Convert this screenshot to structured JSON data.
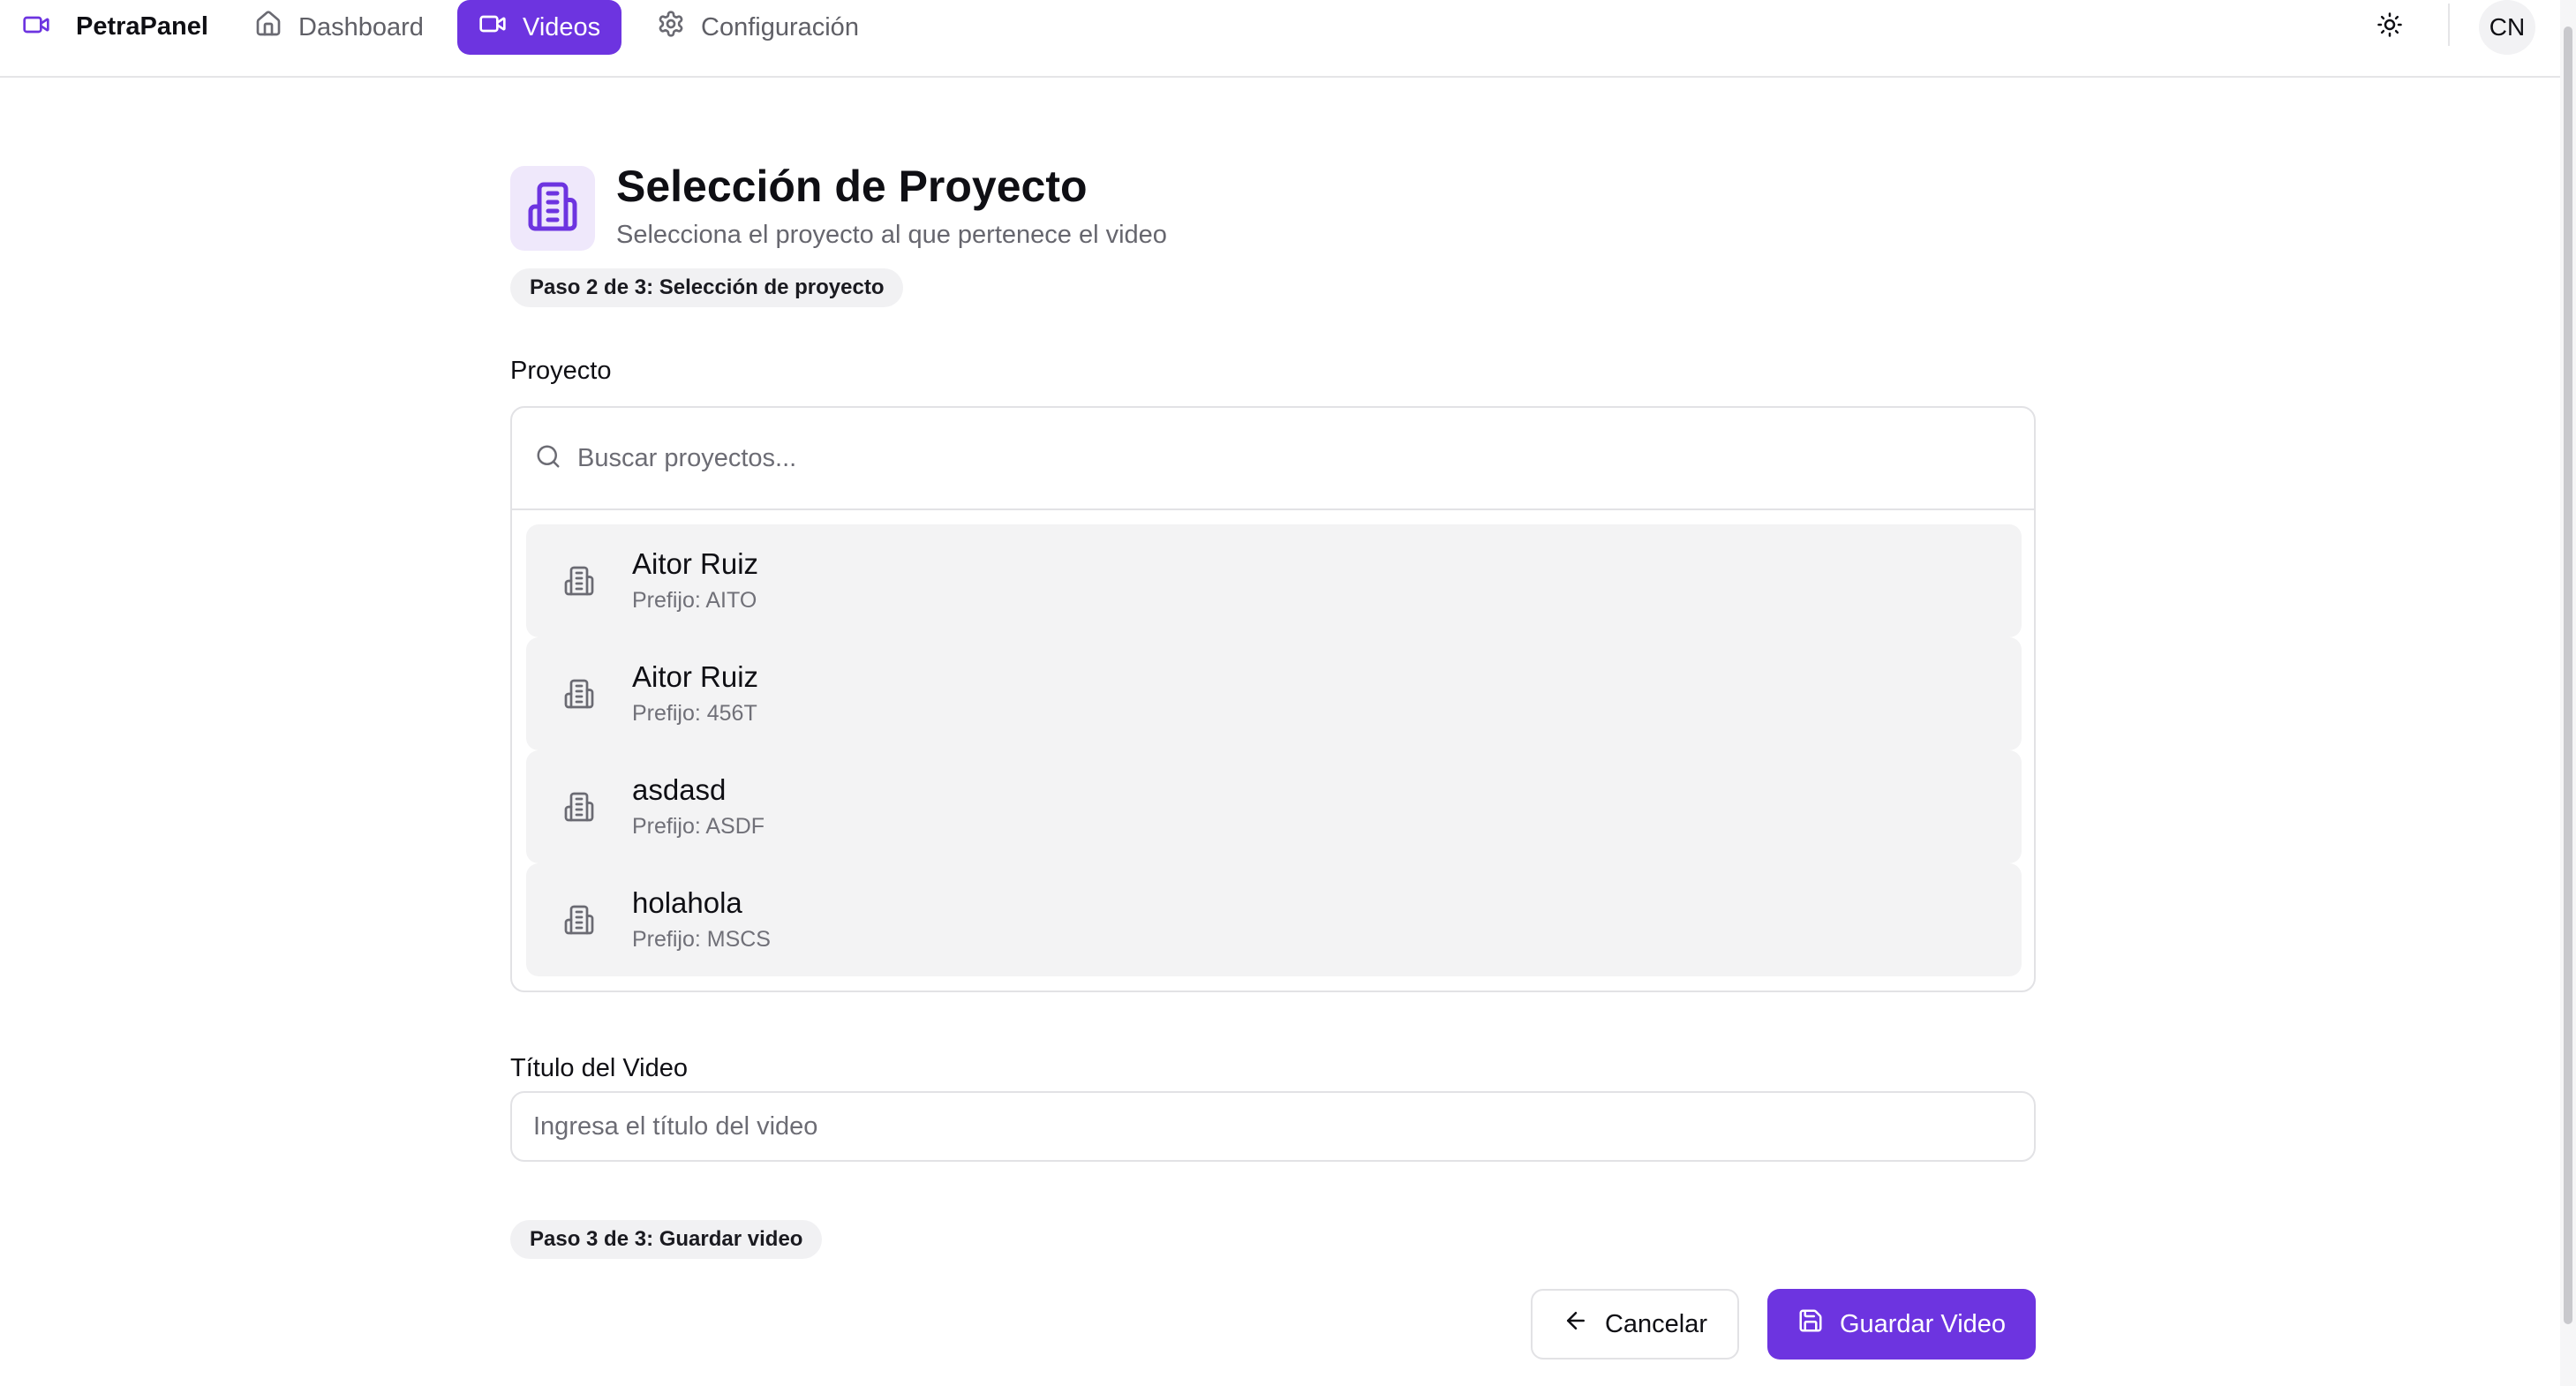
{
  "nav": {
    "brand": "PetraPanel",
    "items": [
      {
        "label": "Dashboard",
        "icon": "home-icon",
        "active": false
      },
      {
        "label": "Videos",
        "icon": "video-icon",
        "active": true
      },
      {
        "label": "Configuración",
        "icon": "gear-icon",
        "active": false
      }
    ],
    "theme_icon": "sun-icon",
    "avatar_initials": "CN"
  },
  "header": {
    "icon": "building-icon",
    "title": "Selección de Proyecto",
    "subtitle": "Selecciona el proyecto al que pertenece el video",
    "step_badge": "Paso 2 de 3: Selección de proyecto"
  },
  "project_field": {
    "label": "Proyecto",
    "search_placeholder": "Buscar proyectos...",
    "search_value": "",
    "projects": [
      {
        "name": "Aitor Ruiz",
        "prefix": "Prefijo: AITO"
      },
      {
        "name": "Aitor Ruiz",
        "prefix": "Prefijo: 456T"
      },
      {
        "name": "asdasd",
        "prefix": "Prefijo: ASDF"
      },
      {
        "name": "holahola",
        "prefix": "Prefijo: MSCS"
      }
    ]
  },
  "title_field": {
    "label": "Título del Video",
    "placeholder": "Ingresa el título del video",
    "value": ""
  },
  "step3_badge": "Paso 3 de 3: Guardar video",
  "actions": {
    "cancel_label": "Cancelar",
    "save_label": "Guardar Video"
  },
  "colors": {
    "accent": "#6d34e0",
    "accent_soft": "#efe8fb",
    "item_bg": "#f3f3f4",
    "border": "#e2e2e5"
  }
}
